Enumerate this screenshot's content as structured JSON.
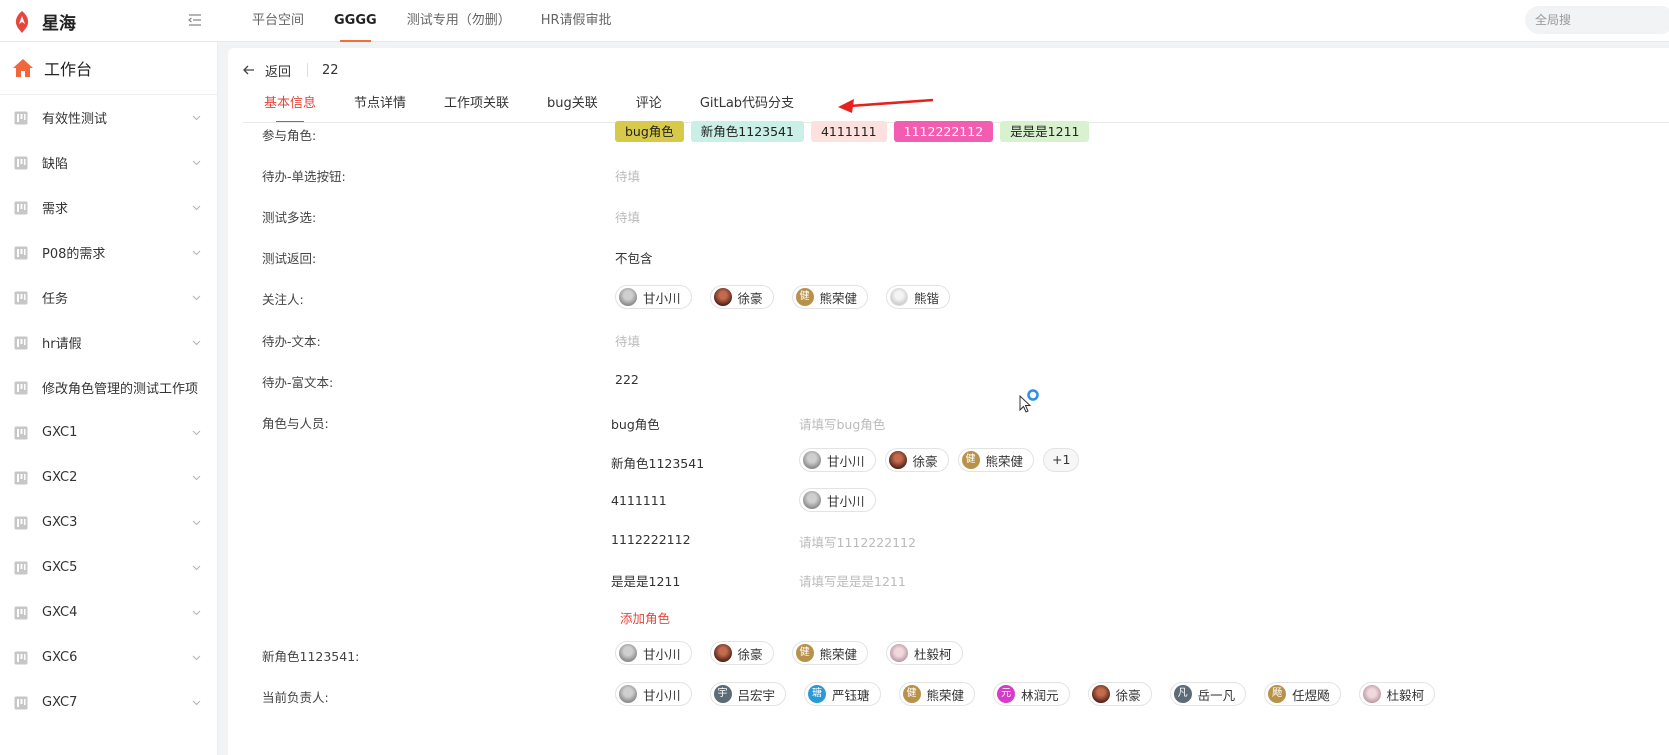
{
  "app": {
    "title": "星海"
  },
  "top_tabs": [
    {
      "label": "平台空间"
    },
    {
      "label": "GGGG"
    },
    {
      "label": "测试专用（勿删）"
    },
    {
      "label": "HR请假审批"
    }
  ],
  "global_search": {
    "label": "全局搜"
  },
  "sidebar": {
    "workbench": "工作台",
    "items": [
      {
        "label": "有效性测试",
        "chevron": true
      },
      {
        "label": "缺陷",
        "chevron": true
      },
      {
        "label": "需求",
        "chevron": true
      },
      {
        "label": "P08的需求",
        "chevron": true
      },
      {
        "label": "任务",
        "chevron": true
      },
      {
        "label": "hr请假",
        "chevron": true
      },
      {
        "label": "修改角色管理的测试工作项",
        "chevron": false
      },
      {
        "label": "GXC1",
        "chevron": true
      },
      {
        "label": "GXC2",
        "chevron": true
      },
      {
        "label": "GXC3",
        "chevron": true
      },
      {
        "label": "GXC5",
        "chevron": true
      },
      {
        "label": "GXC4",
        "chevron": true
      },
      {
        "label": "GXC6",
        "chevron": true
      },
      {
        "label": "GXC7",
        "chevron": true
      }
    ]
  },
  "header": {
    "back": "返回",
    "id": "22"
  },
  "detail_tabs": [
    {
      "label": "基本信息",
      "active": true
    },
    {
      "label": "节点详情",
      "active": false
    },
    {
      "label": "工作项关联",
      "active": false
    },
    {
      "label": "bug关联",
      "active": false
    },
    {
      "label": "评论",
      "active": false
    },
    {
      "label": "GitLab代码分支",
      "active": false
    }
  ],
  "fields": {
    "participant_roles": {
      "label": "参与角色:",
      "tags": [
        {
          "text": "bug角色",
          "bg": "#d7c94a"
        },
        {
          "text": "新角色1123541",
          "bg": "#c9efe6"
        },
        {
          "text": "4111111",
          "bg": "#fde1de"
        },
        {
          "text": "1112222112",
          "bg": "#f25db2",
          "fg": "#ffffff"
        },
        {
          "text": "是是是1211",
          "bg": "#d8f2d0"
        }
      ]
    },
    "todo_radio": {
      "label": "待办-单选按钮:",
      "value": "待填"
    },
    "test_multi": {
      "label": "测试多选:",
      "value": "待填"
    },
    "test_return": {
      "label": "测试返回:",
      "value": "不包含"
    },
    "followers": {
      "label": "关注人:",
      "people": [
        {
          "name": "甘小川",
          "avatar": "photo1"
        },
        {
          "name": "徐豪",
          "avatar": "photo2"
        },
        {
          "name": "熊荣健",
          "avatar": "char",
          "char": "健",
          "color": "#b8924a"
        },
        {
          "name": "熊锴",
          "avatar": "photo3"
        }
      ]
    },
    "todo_text": {
      "label": "待办-文本:",
      "value": "待填"
    },
    "todo_rich_text": {
      "label": "待办-富文本:",
      "value": "222"
    },
    "roles_people": {
      "label": "角色与人员:",
      "rows": [
        {
          "role": "bug角色",
          "placeholder": "请填写bug角色",
          "people": []
        },
        {
          "role": "新角色1123541",
          "placeholder": "",
          "people": [
            {
              "name": "甘小川",
              "avatar": "photo1"
            },
            {
              "name": "徐豪",
              "avatar": "photo2"
            },
            {
              "name": "熊荣健",
              "avatar": "char",
              "char": "健",
              "color": "#b8924a"
            }
          ],
          "more": "+1"
        },
        {
          "role": "4111111",
          "placeholder": "",
          "people": [
            {
              "name": "甘小川",
              "avatar": "photo1"
            }
          ]
        },
        {
          "role": "1112222112",
          "placeholder": "请填写1112222112",
          "people": []
        },
        {
          "role": "是是是1211",
          "placeholder": "请填写是是是1211",
          "people": []
        }
      ],
      "add_role": "添加角色"
    },
    "new_role_field": {
      "label": "新角色1123541:",
      "people": [
        {
          "name": "甘小川",
          "avatar": "photo1"
        },
        {
          "name": "徐豪",
          "avatar": "photo2"
        },
        {
          "name": "熊荣健",
          "avatar": "char",
          "char": "健",
          "color": "#b8924a"
        },
        {
          "name": "杜毅柯",
          "avatar": "photo4"
        }
      ]
    },
    "current_owner": {
      "label": "当前负责人:",
      "people": [
        {
          "name": "甘小川",
          "avatar": "photo1"
        },
        {
          "name": "吕宏宇",
          "avatar": "char",
          "char": "宇",
          "color": "#5d6b78"
        },
        {
          "name": "严钰瑭",
          "avatar": "char",
          "char": "瑭",
          "color": "#2a9ad6"
        },
        {
          "name": "熊荣健",
          "avatar": "char",
          "char": "健",
          "color": "#b8924a"
        },
        {
          "name": "林润元",
          "avatar": "char",
          "char": "元",
          "color": "#d63bc9"
        },
        {
          "name": "徐豪",
          "avatar": "photo2"
        },
        {
          "name": "岳一凡",
          "avatar": "char",
          "char": "凡",
          "color": "#5d6b78"
        },
        {
          "name": "任煜飏",
          "avatar": "char",
          "char": "飏",
          "color": "#b8924a"
        },
        {
          "name": "杜毅柯",
          "avatar": "photo4"
        }
      ]
    }
  },
  "colors": {
    "accent": "#e8453c",
    "brand_orange": "#f0703c"
  }
}
